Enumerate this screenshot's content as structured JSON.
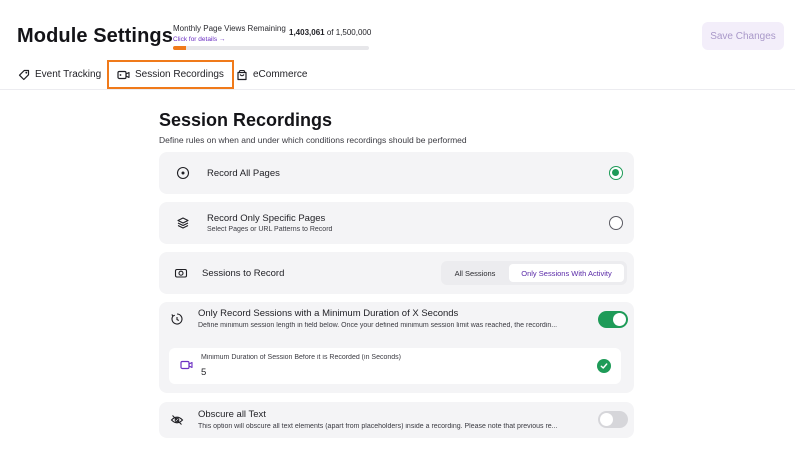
{
  "header": {
    "title": "Module Settings",
    "save_label": "Save Changes"
  },
  "quota": {
    "label": "Monthly Page Views Remaining",
    "link": "Click for details →",
    "remaining": "1,403,061",
    "of_total": "of 1,500,000",
    "used_fraction": 0.065
  },
  "tabs": [
    {
      "label": "Event Tracking",
      "icon": "tag-icon",
      "active": false
    },
    {
      "label": "Session Recordings",
      "icon": "video-icon",
      "active": true
    },
    {
      "label": "eCommerce",
      "icon": "shopping-bag-icon",
      "active": false
    }
  ],
  "section": {
    "title": "Session Recordings",
    "description": "Define rules on when and under which conditions recordings should be performed"
  },
  "options": {
    "record_all": {
      "label": "Record All Pages",
      "selected": true,
      "icon": "target-icon"
    },
    "record_specific": {
      "label": "Record Only Specific Pages",
      "sub": "Select Pages or URL Patterns to Record",
      "selected": false,
      "icon": "layers-icon"
    },
    "sessions": {
      "label": "Sessions to Record",
      "icon": "camera-icon",
      "choices": [
        "All Sessions",
        "Only Sessions With Activity"
      ],
      "selected_index": 1
    },
    "min_duration": {
      "label": "Only Record Sessions with a Minimum Duration of X Seconds",
      "sub": "Define minimum session length in field below. Once your defined minimum session limit was reached, the recordin...",
      "enabled": true,
      "icon": "timer-icon",
      "field_label": "Minimum Duration of Session Before it is Recorded (in Seconds)",
      "field_value": "5"
    },
    "obscure": {
      "label": "Obscure all Text",
      "sub": "This option will obscure all text elements (apart from placeholders) inside a recording. Please note that previous re...",
      "enabled": false,
      "icon": "eye-off-icon"
    }
  },
  "colors": {
    "accent": "#f07a1a",
    "brand": "#6b2fc2",
    "success": "#1e9b58"
  }
}
